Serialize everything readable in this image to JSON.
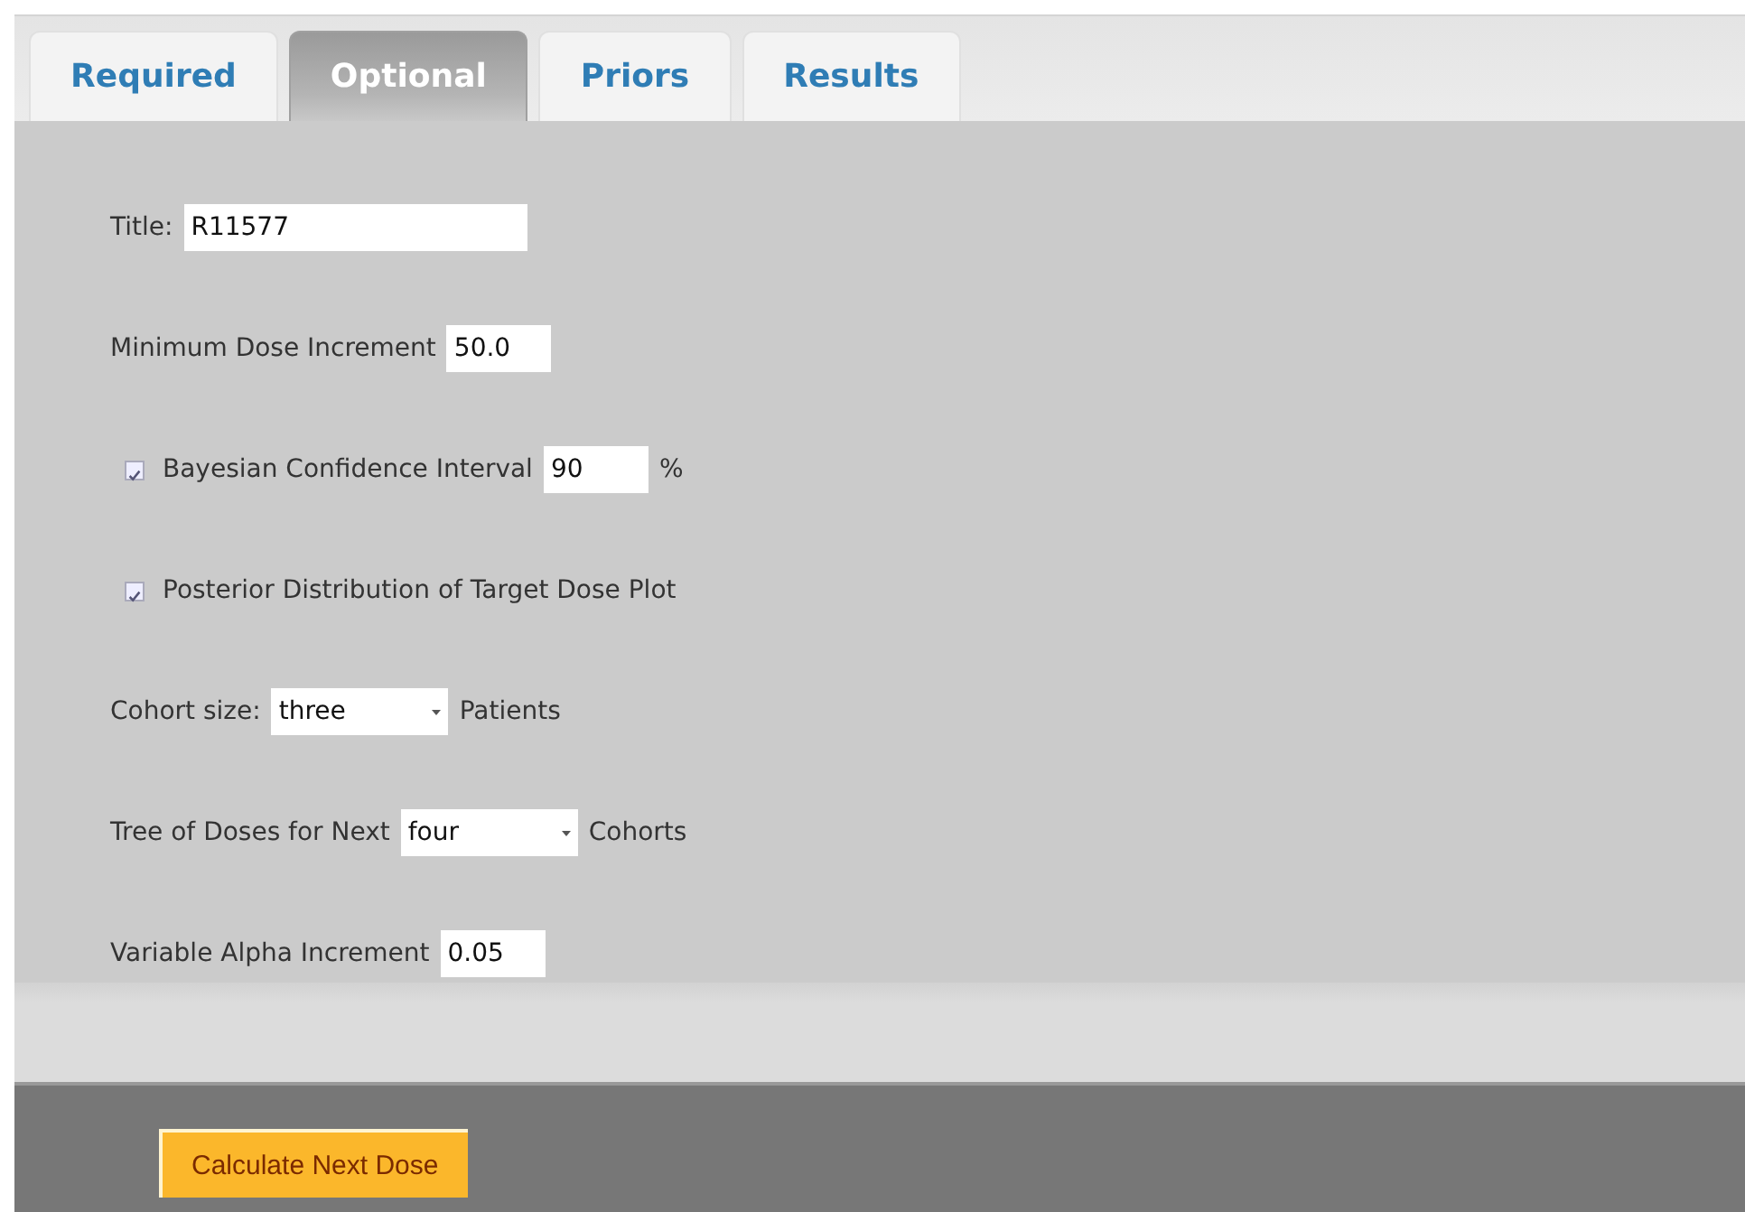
{
  "tabs": [
    {
      "label": "Required",
      "selected": false
    },
    {
      "label": "Optional",
      "selected": true
    },
    {
      "label": "Priors",
      "selected": false
    },
    {
      "label": "Results",
      "selected": false
    }
  ],
  "fields": [
    {
      "kind": "wide",
      "label": "Title:",
      "value": "R11577"
    },
    {
      "kind": "text",
      "label": "Minimum Dose Increment",
      "value": "50.0"
    },
    {
      "kind": "checkbox",
      "checked": true,
      "label": "Bayesian Confidence Interval",
      "value": "90",
      "suffix": "%"
    },
    {
      "kind": "checkbox",
      "checked": true,
      "label": "Posterior Distribution of Target Dose Plot"
    },
    {
      "kind": "select",
      "label": "Cohort size:",
      "value": "three",
      "suffix": "Patients"
    },
    {
      "kind": "select",
      "label": "Tree of Doses for Next",
      "value": "four",
      "suffix": "Cohorts"
    },
    {
      "kind": "text",
      "label": "Variable Alpha Increment",
      "value": "0.05"
    }
  ],
  "button": "Calculate Next Dose"
}
